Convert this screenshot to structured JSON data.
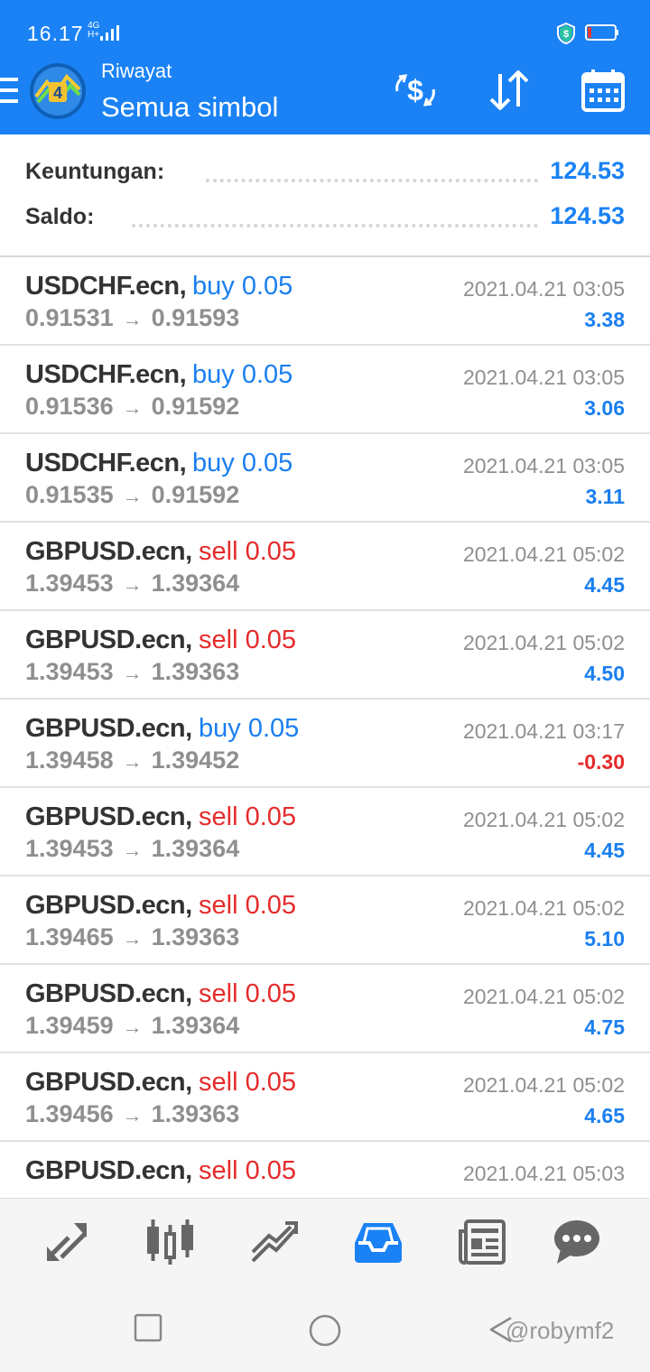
{
  "status_bar": {
    "time": "16.17",
    "network": "4G H+",
    "colors": {
      "bar": "#1a82f5"
    }
  },
  "header": {
    "title": "Riwayat",
    "subtitle": "Semua simbol",
    "actions": [
      "currency-exchange-icon",
      "sort-icon",
      "calendar-icon"
    ]
  },
  "summary": {
    "profit_label": "Keuntungan:",
    "profit_value": "124.53",
    "balance_label": "Saldo:",
    "balance_value": "124.53"
  },
  "trades": [
    {
      "symbol": "USDCHF.ecn,",
      "type": "buy 0.05",
      "side": "buy",
      "open": "0.91531",
      "close": "0.91593",
      "time": "2021.04.21 03:05",
      "profit": "3.38"
    },
    {
      "symbol": "USDCHF.ecn,",
      "type": "buy 0.05",
      "side": "buy",
      "open": "0.91536",
      "close": "0.91592",
      "time": "2021.04.21 03:05",
      "profit": "3.06"
    },
    {
      "symbol": "USDCHF.ecn,",
      "type": "buy 0.05",
      "side": "buy",
      "open": "0.91535",
      "close": "0.91592",
      "time": "2021.04.21 03:05",
      "profit": "3.11"
    },
    {
      "symbol": "GBPUSD.ecn,",
      "type": "sell 0.05",
      "side": "sell",
      "open": "1.39453",
      "close": "1.39364",
      "time": "2021.04.21 05:02",
      "profit": "4.45"
    },
    {
      "symbol": "GBPUSD.ecn,",
      "type": "sell 0.05",
      "side": "sell",
      "open": "1.39453",
      "close": "1.39363",
      "time": "2021.04.21 05:02",
      "profit": "4.50"
    },
    {
      "symbol": "GBPUSD.ecn,",
      "type": "buy 0.05",
      "side": "buy",
      "open": "1.39458",
      "close": "1.39452",
      "time": "2021.04.21 03:17",
      "profit": "-0.30"
    },
    {
      "symbol": "GBPUSD.ecn,",
      "type": "sell 0.05",
      "side": "sell",
      "open": "1.39453",
      "close": "1.39364",
      "time": "2021.04.21 05:02",
      "profit": "4.45"
    },
    {
      "symbol": "GBPUSD.ecn,",
      "type": "sell 0.05",
      "side": "sell",
      "open": "1.39465",
      "close": "1.39363",
      "time": "2021.04.21 05:02",
      "profit": "5.10"
    },
    {
      "symbol": "GBPUSD.ecn,",
      "type": "sell 0.05",
      "side": "sell",
      "open": "1.39459",
      "close": "1.39364",
      "time": "2021.04.21 05:02",
      "profit": "4.75"
    },
    {
      "symbol": "GBPUSD.ecn,",
      "type": "sell 0.05",
      "side": "sell",
      "open": "1.39456",
      "close": "1.39363",
      "time": "2021.04.21 05:02",
      "profit": "4.65"
    },
    {
      "symbol": "GBPUSD.ecn,",
      "type": "sell 0.05",
      "side": "sell",
      "open": "",
      "close": "",
      "time": "2021.04.21 05:03",
      "profit": ""
    }
  ],
  "bottom_nav": {
    "items": [
      "quotes-icon",
      "chart-icon",
      "trade-icon",
      "history-icon",
      "news-icon",
      "chat-icon"
    ],
    "active": "history-icon"
  },
  "watermark": "@robymf2",
  "colors": {
    "accent": "#1a82f5",
    "sell": "#e52b2b",
    "muted": "#8f8f8f",
    "text": "#333333"
  }
}
